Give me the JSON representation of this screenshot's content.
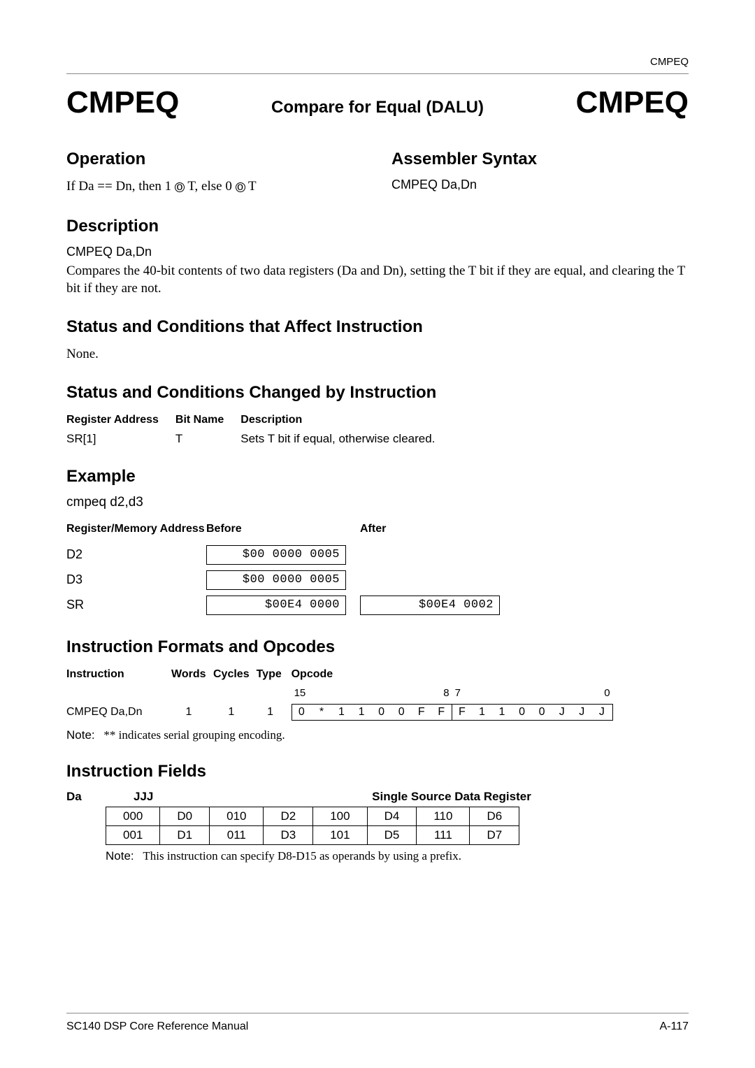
{
  "header_tag": "CMPEQ",
  "title": {
    "left": "CMPEQ",
    "center": "Compare for Equal (DALU)",
    "right": "CMPEQ"
  },
  "operation": {
    "heading": "Operation",
    "text_before": "If Da == Dn, then 1 ",
    "text_mid": " T, else 0 ",
    "text_after": " T"
  },
  "assembler": {
    "heading": "Assembler Syntax",
    "text": "CMPEQ Da,Dn"
  },
  "description": {
    "heading": "Description",
    "sub": "CMPEQ Da,Dn",
    "body": "Compares the 40-bit contents of two data registers (Da and Dn), setting the T bit if they are equal, and clearing the T bit if they are not."
  },
  "status_affect": {
    "heading": "Status and Conditions that Affect Instruction",
    "body": "None."
  },
  "status_changed": {
    "heading": "Status and Conditions Changed by Instruction",
    "headers": [
      "Register Address",
      "Bit Name",
      "Description"
    ],
    "row": {
      "address": "SR[1]",
      "bit": "T",
      "desc": "Sets T bit if equal, otherwise cleared."
    }
  },
  "example": {
    "heading": "Example",
    "code": "cmpeq d2,d3",
    "headers": [
      "Register/Memory Address",
      "Before",
      "After"
    ],
    "rows": [
      {
        "label": "D2",
        "before": "$00 0000 0005",
        "after": ""
      },
      {
        "label": "D3",
        "before": "$00 0000 0005",
        "after": ""
      },
      {
        "label": "SR",
        "before": "$00E4 0000",
        "after": "$00E4 0002"
      }
    ]
  },
  "formats": {
    "heading": "Instruction Formats and Opcodes",
    "headers": [
      "Instruction",
      "Words",
      "Cycles",
      "Type",
      "Opcode"
    ],
    "bit_labels": {
      "hi": "15",
      "midhi": "8",
      "midlo": "7",
      "lo": "0"
    },
    "row": {
      "instr": "CMPEQ Da,Dn",
      "words": "1",
      "cycles": "1",
      "type": "1",
      "opcode": [
        "0",
        "*",
        "1",
        "1",
        "0",
        "0",
        "F",
        "F",
        "F",
        "1",
        "1",
        "0",
        "0",
        "J",
        "J",
        "J"
      ]
    },
    "note_label": "Note:",
    "note_text": "** indicates serial grouping encoding."
  },
  "fields": {
    "heading": "Instruction Fields",
    "da_label": "Da",
    "jjj_label": "JJJ",
    "subhead": "Single Source Data Register",
    "rows": [
      [
        "000",
        "D0",
        "010",
        "D2",
        "100",
        "D4",
        "110",
        "D6"
      ],
      [
        "001",
        "D1",
        "011",
        "D3",
        "101",
        "D5",
        "111",
        "D7"
      ]
    ],
    "note_label": "Note:",
    "note_text": "This instruction can specify D8-D15 as operands by using a prefix."
  },
  "footer": {
    "left": "SC140 DSP Core Reference Manual",
    "right": "A-117"
  }
}
